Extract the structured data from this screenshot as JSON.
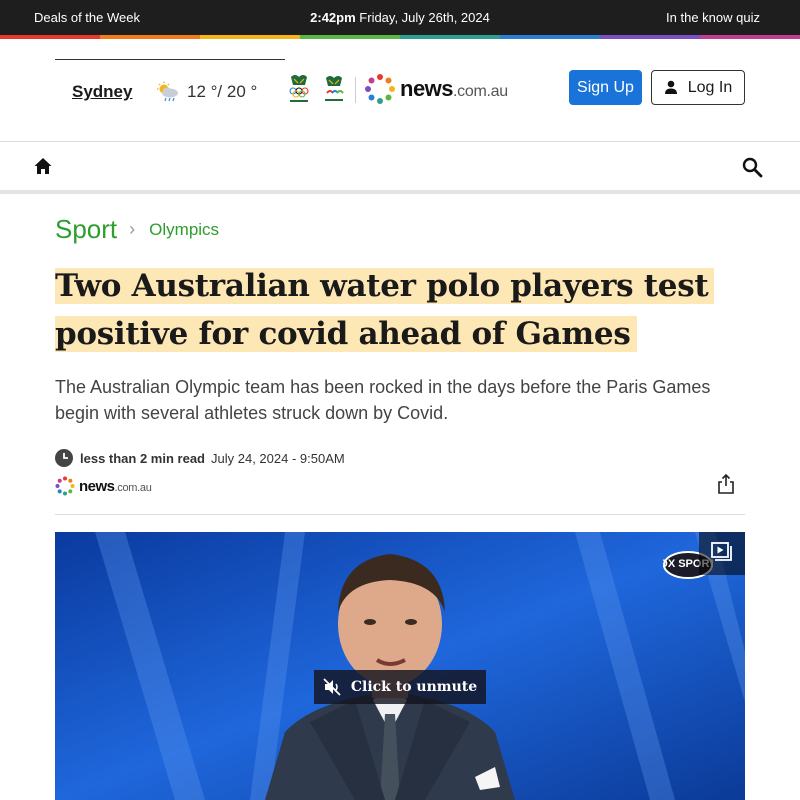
{
  "topbar": {
    "left_link": "Deals of the Week",
    "time": "2:42pm",
    "date": "Friday, July 26th, 2024",
    "right_link": "In the know quiz",
    "stripe_colors": [
      "#e8392d",
      "#f07d1a",
      "#f5b419",
      "#5cb545",
      "#2e9e8f",
      "#2a7fd4",
      "#7a4fc1",
      "#c33d8e"
    ]
  },
  "header": {
    "city": "Sydney",
    "weather_icon": "partly-cloudy-rain-icon",
    "temperature": "12 °/ 20 °",
    "logo": {
      "brand": "news",
      "domain": ".com.au"
    },
    "signup_label": "Sign Up",
    "login_label": "Log In",
    "colors": {
      "signup_bg": "#1a73d9"
    }
  },
  "nav": {
    "home_icon": "home-icon",
    "search_icon": "search-icon"
  },
  "breadcrumb": {
    "section": "Sport",
    "subsection": "Olympics",
    "accent": "#2e9e2e"
  },
  "article": {
    "headline_line1": "Two Australian water polo players test",
    "headline_line2": "positive for covid ahead of Games",
    "standfirst": "The Australian Olympic team has been rocked in the days before the Paris Games begin with several athletes struck down by Covid.",
    "read_time": "less than 2 min read",
    "published": "July 24, 2024 - 9:50AM",
    "source_logo": {
      "brand": "news",
      "domain": ".com.au"
    },
    "highlight_color": "#fde7b5"
  },
  "video": {
    "unmute_label": "Click to unmute",
    "channel_badge": "FOX SPORTS"
  }
}
